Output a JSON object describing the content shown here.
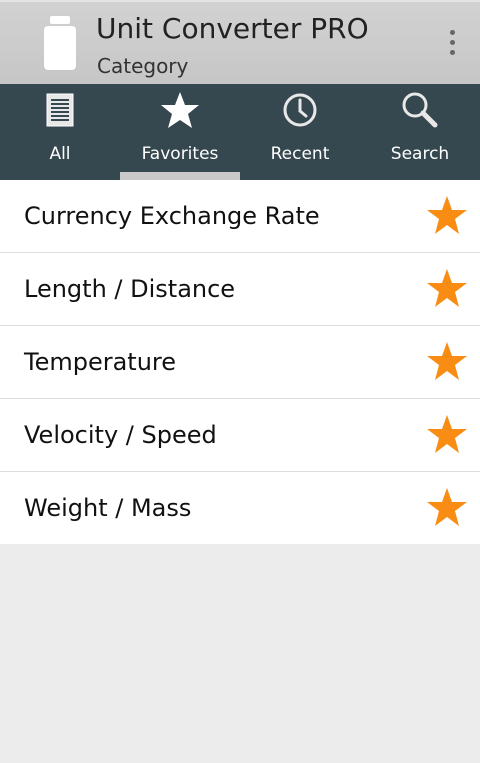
{
  "app": {
    "title": "Unit Converter PRO",
    "subtitle": "Category",
    "icon": "jar-icon",
    "menu_icon": "overflow-menu-icon"
  },
  "tabs": [
    {
      "label": "All",
      "icon": "list-icon",
      "selected": false
    },
    {
      "label": "Favorites",
      "icon": "star-icon",
      "selected": true
    },
    {
      "label": "Recent",
      "icon": "clock-icon",
      "selected": false
    },
    {
      "label": "Search",
      "icon": "search-icon",
      "selected": false
    }
  ],
  "categories": [
    {
      "label": "Currency Exchange Rate",
      "favorite": true
    },
    {
      "label": "Length / Distance",
      "favorite": true
    },
    {
      "label": "Temperature",
      "favorite": true
    },
    {
      "label": "Velocity / Speed",
      "favorite": true
    },
    {
      "label": "Weight / Mass",
      "favorite": true
    }
  ],
  "colors": {
    "action_bar": "#c8c8c8",
    "tab_bar": "#35474f",
    "tab_indicator": "#c9c9c9",
    "favorite_star": "#f98c12",
    "background": "#ececec"
  }
}
